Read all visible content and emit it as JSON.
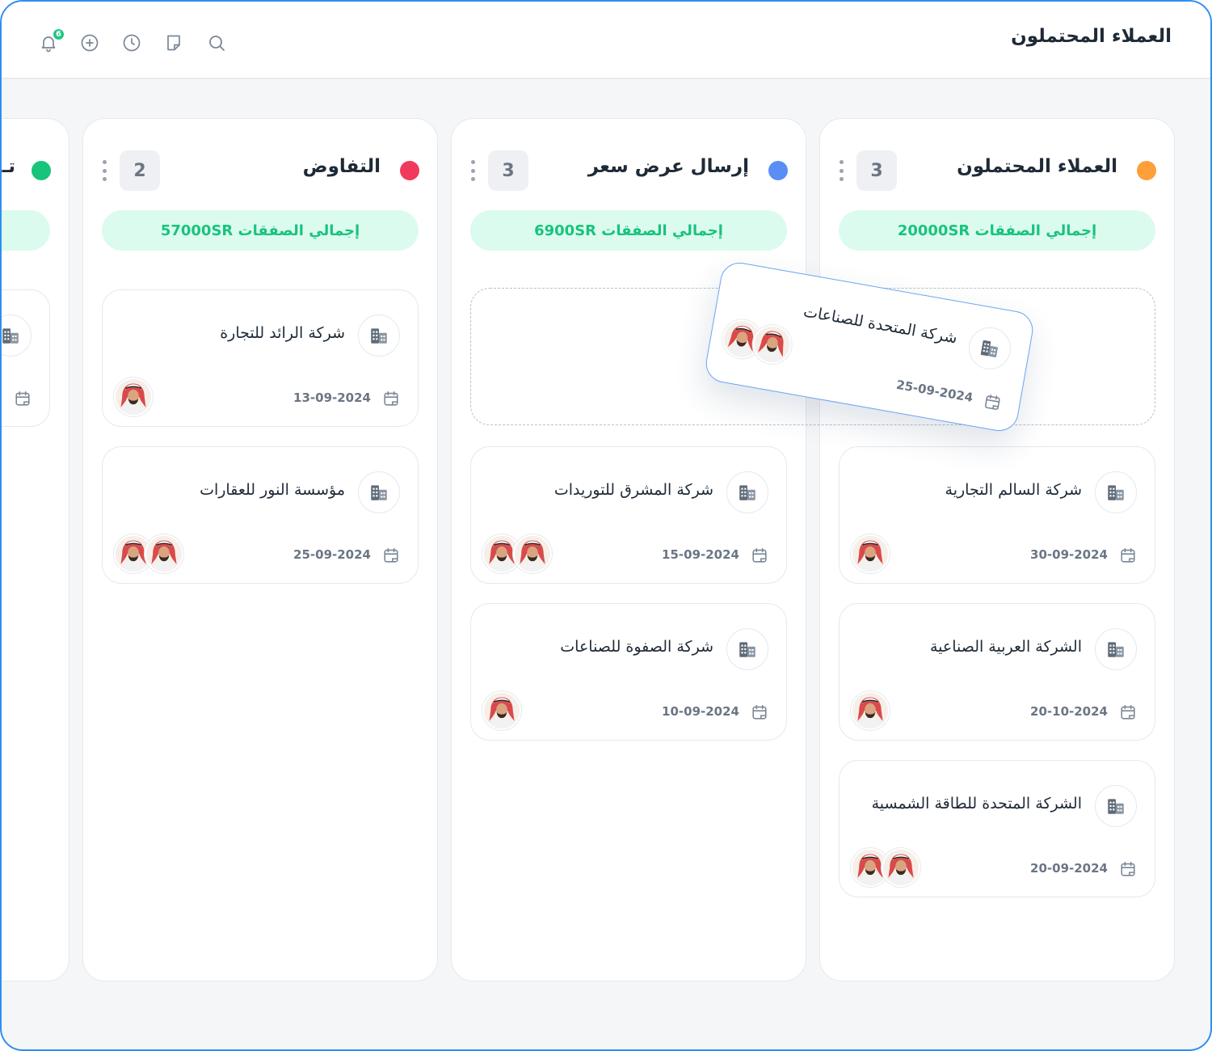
{
  "header": {
    "title": "العملاء المحتملون",
    "notification_count": "6"
  },
  "columns": [
    {
      "title": "العملاء المحتملون",
      "dot_color": "#ff9f3a",
      "count": "3",
      "total": "إجمالي الصفقات 20000SR",
      "cards": [
        {
          "name": "شركة السالم التجارية",
          "date": "30-09-2024",
          "avatars": 1
        },
        {
          "name": "الشركة العربية الصناعية",
          "date": "20-10-2024",
          "avatars": 1
        },
        {
          "name": "الشركة المتحدة للطاقة الشمسية",
          "date": "20-09-2024",
          "avatars": 2
        }
      ]
    },
    {
      "title": "إرسال عرض سعر",
      "dot_color": "#5b8ef5",
      "count": "3",
      "total": "إجمالي الصفقات 6900SR",
      "cards": [
        {
          "name": "شركة المشرق للتوريدات",
          "date": "15-09-2024",
          "avatars": 2
        },
        {
          "name": "شركة الصفوة للصناعات",
          "date": "10-09-2024",
          "avatars": 1
        }
      ]
    },
    {
      "title": "التفاوض",
      "dot_color": "#f13a5b",
      "count": "2",
      "total": "إجمالي الصفقات 57000SR",
      "cards": [
        {
          "name": "شركة الرائد للتجارة",
          "date": "13-09-2024",
          "avatars": 1
        },
        {
          "name": "مؤسسة النور للعقارات",
          "date": "25-09-2024",
          "avatars": 2
        }
      ]
    },
    {
      "title": "تـ",
      "dot_color": "#17c47a"
    }
  ],
  "dragging_card": {
    "name": "شركة المتحدة للصناعات",
    "date": "25-09-2024",
    "avatars": 2
  }
}
